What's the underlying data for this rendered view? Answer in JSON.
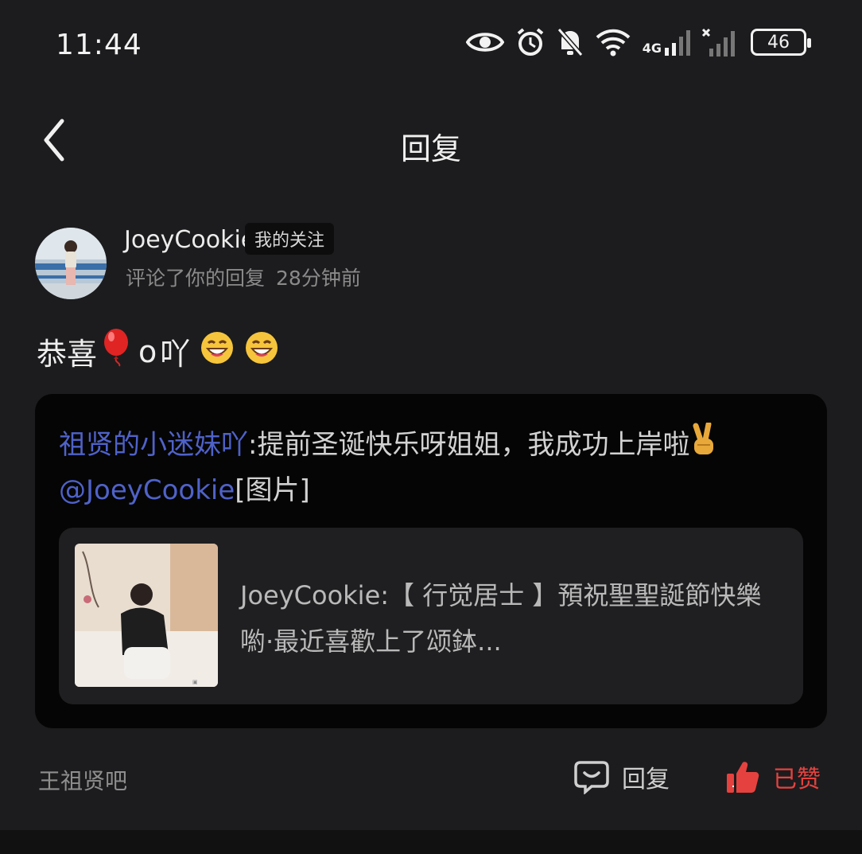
{
  "status_bar": {
    "time": "11:44",
    "network_label": "4G",
    "battery": "46",
    "icons": [
      "eye-icon",
      "alarm-icon",
      "mute-bell-icon",
      "wifi-icon",
      "signal-4g-icon",
      "signal-no-sim-icon",
      "battery-icon"
    ]
  },
  "navbar": {
    "back_icon": "chevron-left-icon",
    "title": "回复"
  },
  "notification": {
    "username": "JoeyCookie",
    "follow_badge": "我的关注",
    "action": "评论了你的回复",
    "time_ago": "28分钟前",
    "comment_text": "恭喜",
    "comment_suffix": "吖",
    "comment_emojis": [
      "balloon",
      "grinning-face",
      "grinning-face"
    ]
  },
  "quote": {
    "author": "祖贤的小迷妹吖",
    "separator": ":",
    "text_main": "提前圣诞快乐呀姐姐，我成功上岸啦",
    "mention": "@JoeyCookie",
    "image_tag": "[图片]",
    "post": {
      "author": "JoeyCookie",
      "text": ":【 行觉居士 】預祝聖聖誕節快樂喲·最近喜歡上了颂鉢..."
    }
  },
  "footer": {
    "forum_name": "王祖贤吧",
    "reply_label": "回复",
    "like_label": "已赞"
  },
  "colors": {
    "background": "#1c1c1e",
    "quote_background": "#050505",
    "card_background": "#1f1f21",
    "link_blue": "#4f62c9",
    "like_red": "#e5423f"
  }
}
